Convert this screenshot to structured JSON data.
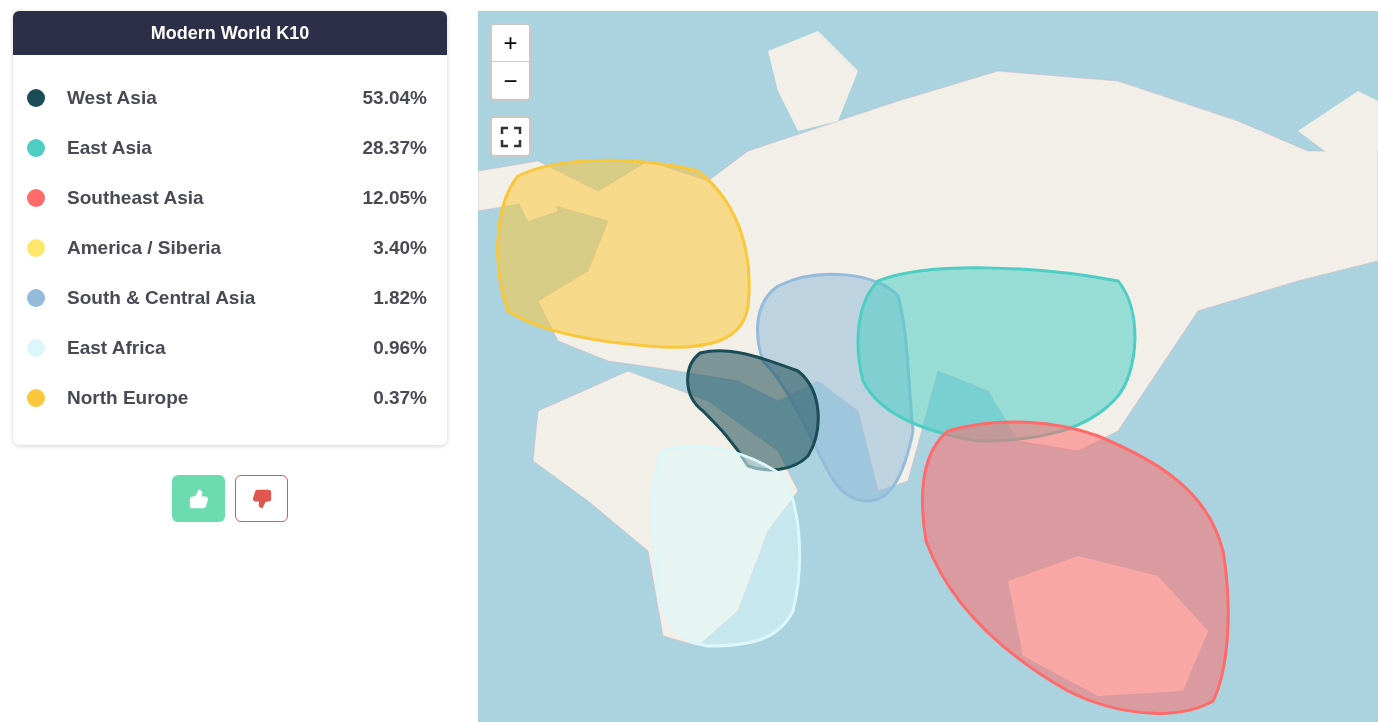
{
  "legend": {
    "title": "Modern World K10",
    "items": [
      {
        "name": "West Asia",
        "value": "53.04%",
        "color": "#1b4d56"
      },
      {
        "name": "East Asia",
        "value": "28.37%",
        "color": "#4ecdc4"
      },
      {
        "name": "Southeast Asia",
        "value": "12.05%",
        "color": "#ff6b6b"
      },
      {
        "name": "America / Siberia",
        "value": "3.40%",
        "color": "#ffe66d"
      },
      {
        "name": "South & Central Asia",
        "value": "1.82%",
        "color": "#94bbd9"
      },
      {
        "name": "East Africa",
        "value": "0.96%",
        "color": "#dcf7fa"
      },
      {
        "name": "North Europe",
        "value": "0.37%",
        "color": "#f9c73b"
      }
    ]
  },
  "map": {
    "zoom_in": "+",
    "zoom_out": "−",
    "regions": [
      {
        "kind": "europe",
        "color": "#f9c73b"
      },
      {
        "kind": "southasia",
        "color": "#94bbd9"
      },
      {
        "kind": "eastasia",
        "color": "#4ecdc4"
      },
      {
        "kind": "westasia",
        "color": "#1b4d56"
      },
      {
        "kind": "africa",
        "color": "#dcf7fa"
      },
      {
        "kind": "oceania",
        "color": "#ff6b6b"
      }
    ]
  }
}
